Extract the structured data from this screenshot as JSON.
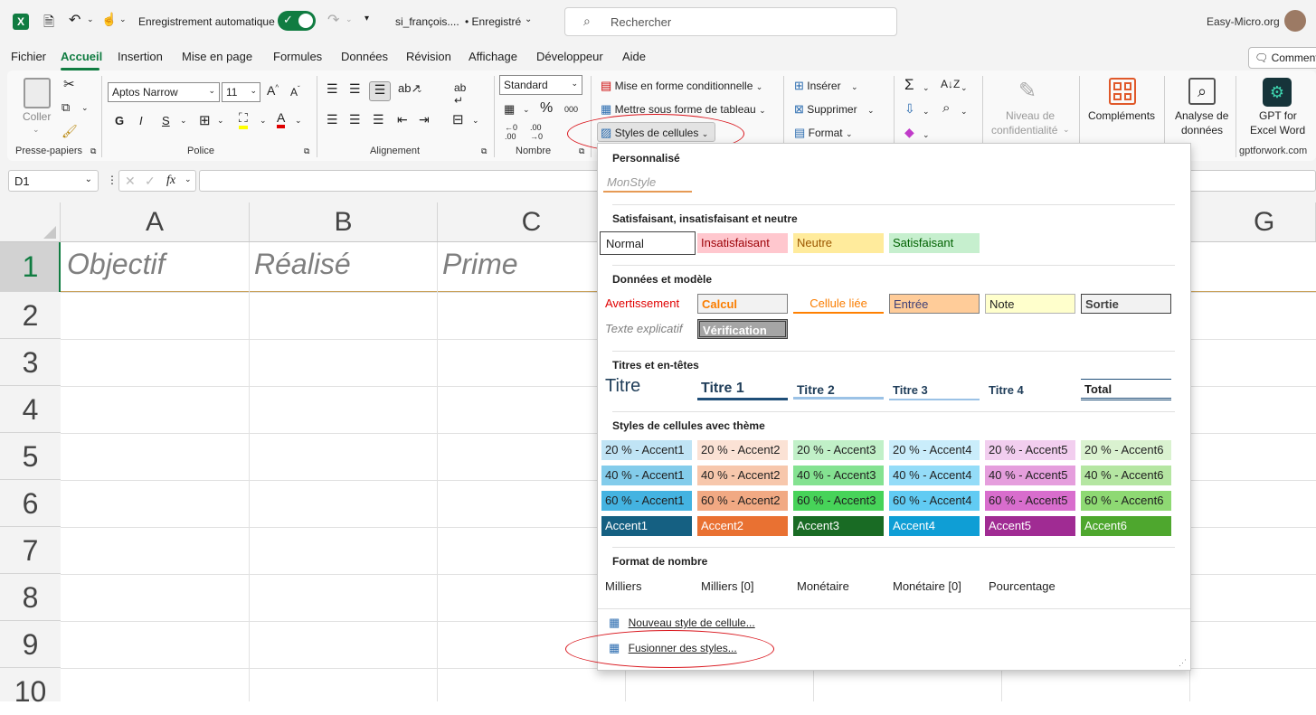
{
  "titlebar": {
    "autosave": "Enregistrement automatique",
    "filename": "si_françois....",
    "saved": "• Enregistré",
    "search_placeholder": "Rechercher",
    "account": "Easy-Micro.org",
    "comments": "Comment"
  },
  "tabs": [
    "Fichier",
    "Accueil",
    "Insertion",
    "Mise en page",
    "Formules",
    "Données",
    "Révision",
    "Affichage",
    "Développeur",
    "Aide"
  ],
  "ribbon": {
    "clipboard": {
      "paste": "Coller",
      "label": "Presse-papiers"
    },
    "font": {
      "name": "Aptos Narrow",
      "size": "11",
      "label": "Police"
    },
    "alignment": {
      "label": "Alignement"
    },
    "number": {
      "format": "Standard",
      "label": "Nombre"
    },
    "styles": {
      "conditional": "Mise en forme conditionnelle",
      "table": "Mettre sous forme de tableau",
      "cell_styles": "Styles de cellules"
    },
    "cells": {
      "insert": "Insérer",
      "delete": "Supprimer",
      "format": "Format"
    },
    "sensitivity": {
      "line1": "Niveau de",
      "line2": "confidentialité"
    },
    "addins": {
      "label": "Compléments"
    },
    "analyze": {
      "line1": "Analyse de",
      "line2": "données"
    },
    "gpt": {
      "line1": "GPT for",
      "line2": "Excel Word",
      "label": "gptforwork.com"
    }
  },
  "formula_bar": {
    "name_box": "D1",
    "fx": "fx"
  },
  "grid": {
    "columns": [
      "A",
      "B",
      "C",
      "G"
    ],
    "rows": [
      "1",
      "2",
      "3",
      "4",
      "5",
      "6",
      "7",
      "8",
      "9",
      "10"
    ],
    "cells": {
      "A1": "Objectif",
      "B1": "Réalisé",
      "C1": "Prime"
    }
  },
  "dropdown": {
    "custom": {
      "title": "Personnalisé",
      "items": [
        "MonStyle"
      ]
    },
    "good_bad": {
      "title": "Satisfaisant, insatisfaisant et neutre",
      "items": [
        "Normal",
        "Insatisfaisant",
        "Neutre",
        "Satisfaisant"
      ]
    },
    "data_model": {
      "title": "Données et modèle",
      "row1": [
        "Avertissement",
        "Calcul",
        "Cellule liée",
        "Entrée",
        "Note",
        "Sortie"
      ],
      "row2": [
        "Texte explicatif",
        "Vérification"
      ]
    },
    "titles": {
      "title": "Titres et en-têtes",
      "items": [
        "Titre",
        "Titre 1",
        "Titre 2",
        "Titre 3",
        "Titre 4",
        "Total"
      ]
    },
    "themed": {
      "title": "Styles de cellules avec thème",
      "row20": [
        "20 % - Accent1",
        "20 % - Accent2",
        "20 % - Accent3",
        "20 % - Accent4",
        "20 % - Accent5",
        "20 % - Accent6"
      ],
      "row40": [
        "40 % - Accent1",
        "40 % - Accent2",
        "40 % - Accent3",
        "40 % - Accent4",
        "40 % - Accent5",
        "40 % - Accent6"
      ],
      "row60": [
        "60 % - Accent1",
        "60 % - Accent2",
        "60 % - Accent3",
        "60 % - Accent4",
        "60 % - Accent5",
        "60 % - Accent6"
      ],
      "row100": [
        "Accent1",
        "Accent2",
        "Accent3",
        "Accent4",
        "Accent5",
        "Accent6"
      ]
    },
    "number_format": {
      "title": "Format de nombre",
      "items": [
        "Milliers",
        "Milliers [0]",
        "Monétaire",
        "Monétaire [0]",
        "Pourcentage"
      ]
    },
    "commands": {
      "new_style": "Nouveau style de cellule...",
      "merge_styles": "Fusionner des styles..."
    }
  },
  "colors": {
    "accent_green": "#107c41",
    "annotation": "#d9141b"
  }
}
